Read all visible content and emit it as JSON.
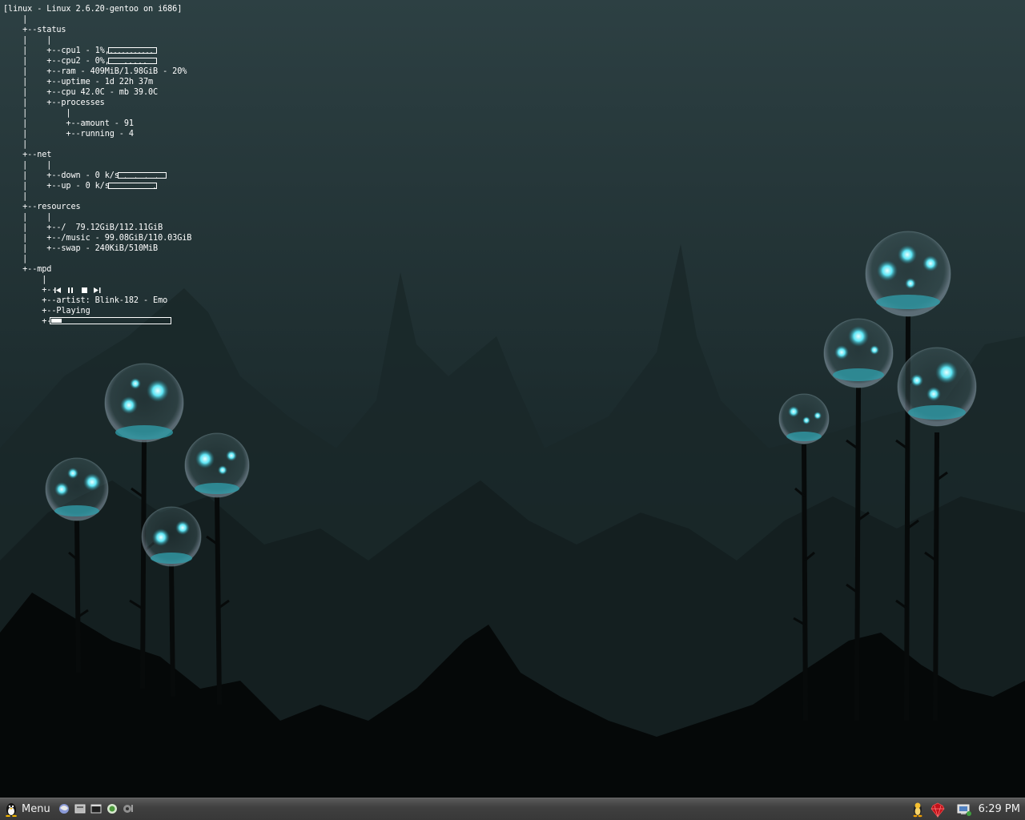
{
  "conky": {
    "lines": [
      "[linux - Linux 2.6.20-gentoo on i686]",
      "    |",
      "    +--status",
      "    |    |",
      "    |    +--cpu1 - 1%,",
      "    |    +--cpu2 - 0%,",
      "    |    +--ram - 409MiB/1.98GiB - 20%",
      "    |    +--uptime - 1d 22h 37m",
      "    |    +--cpu 42.0C - mb 39.0C",
      "    |    +--processes",
      "    |        |",
      "    |        +--amount - 91",
      "    |        +--running - 4",
      "    |",
      "    +--net",
      "    |    |",
      "    |    +--down - 0 k/s",
      "    |    +--up - 0 k/s",
      "    |",
      "    +--resources",
      "    |    |",
      "    |    +--/  79.12GiB/112.11GiB",
      "    |    +--/music - 99.08GiB/110.03GiB",
      "    |    +--swap - 240KiB/510MiB",
      "    |",
      "    +--mpd",
      "        |",
      "        +--",
      "        +--artist: Blink-182 - Emo",
      "        +--Playing",
      "        +--"
    ],
    "mpd_progress": 0.1,
    "mpd_controls": [
      "prev-icon",
      "pause-icon",
      "stop-icon",
      "next-icon"
    ]
  },
  "taskbar": {
    "menu_label": "Menu",
    "menu_icon": "tux-icon",
    "launchers": [
      "web-browser-icon",
      "file-manager-icon",
      "terminal-icon",
      "app-icon",
      "media-icon"
    ],
    "tray": [
      "tux-icon",
      "ruby-icon",
      "network-icon"
    ],
    "clock": "6:29 PM"
  },
  "colors": {
    "wallpaper_top": "#2b3e41",
    "wallpaper_bottom": "#0b1314",
    "glow": "#5ff0ff",
    "taskbar": "#404040",
    "text": "#ffffff"
  }
}
